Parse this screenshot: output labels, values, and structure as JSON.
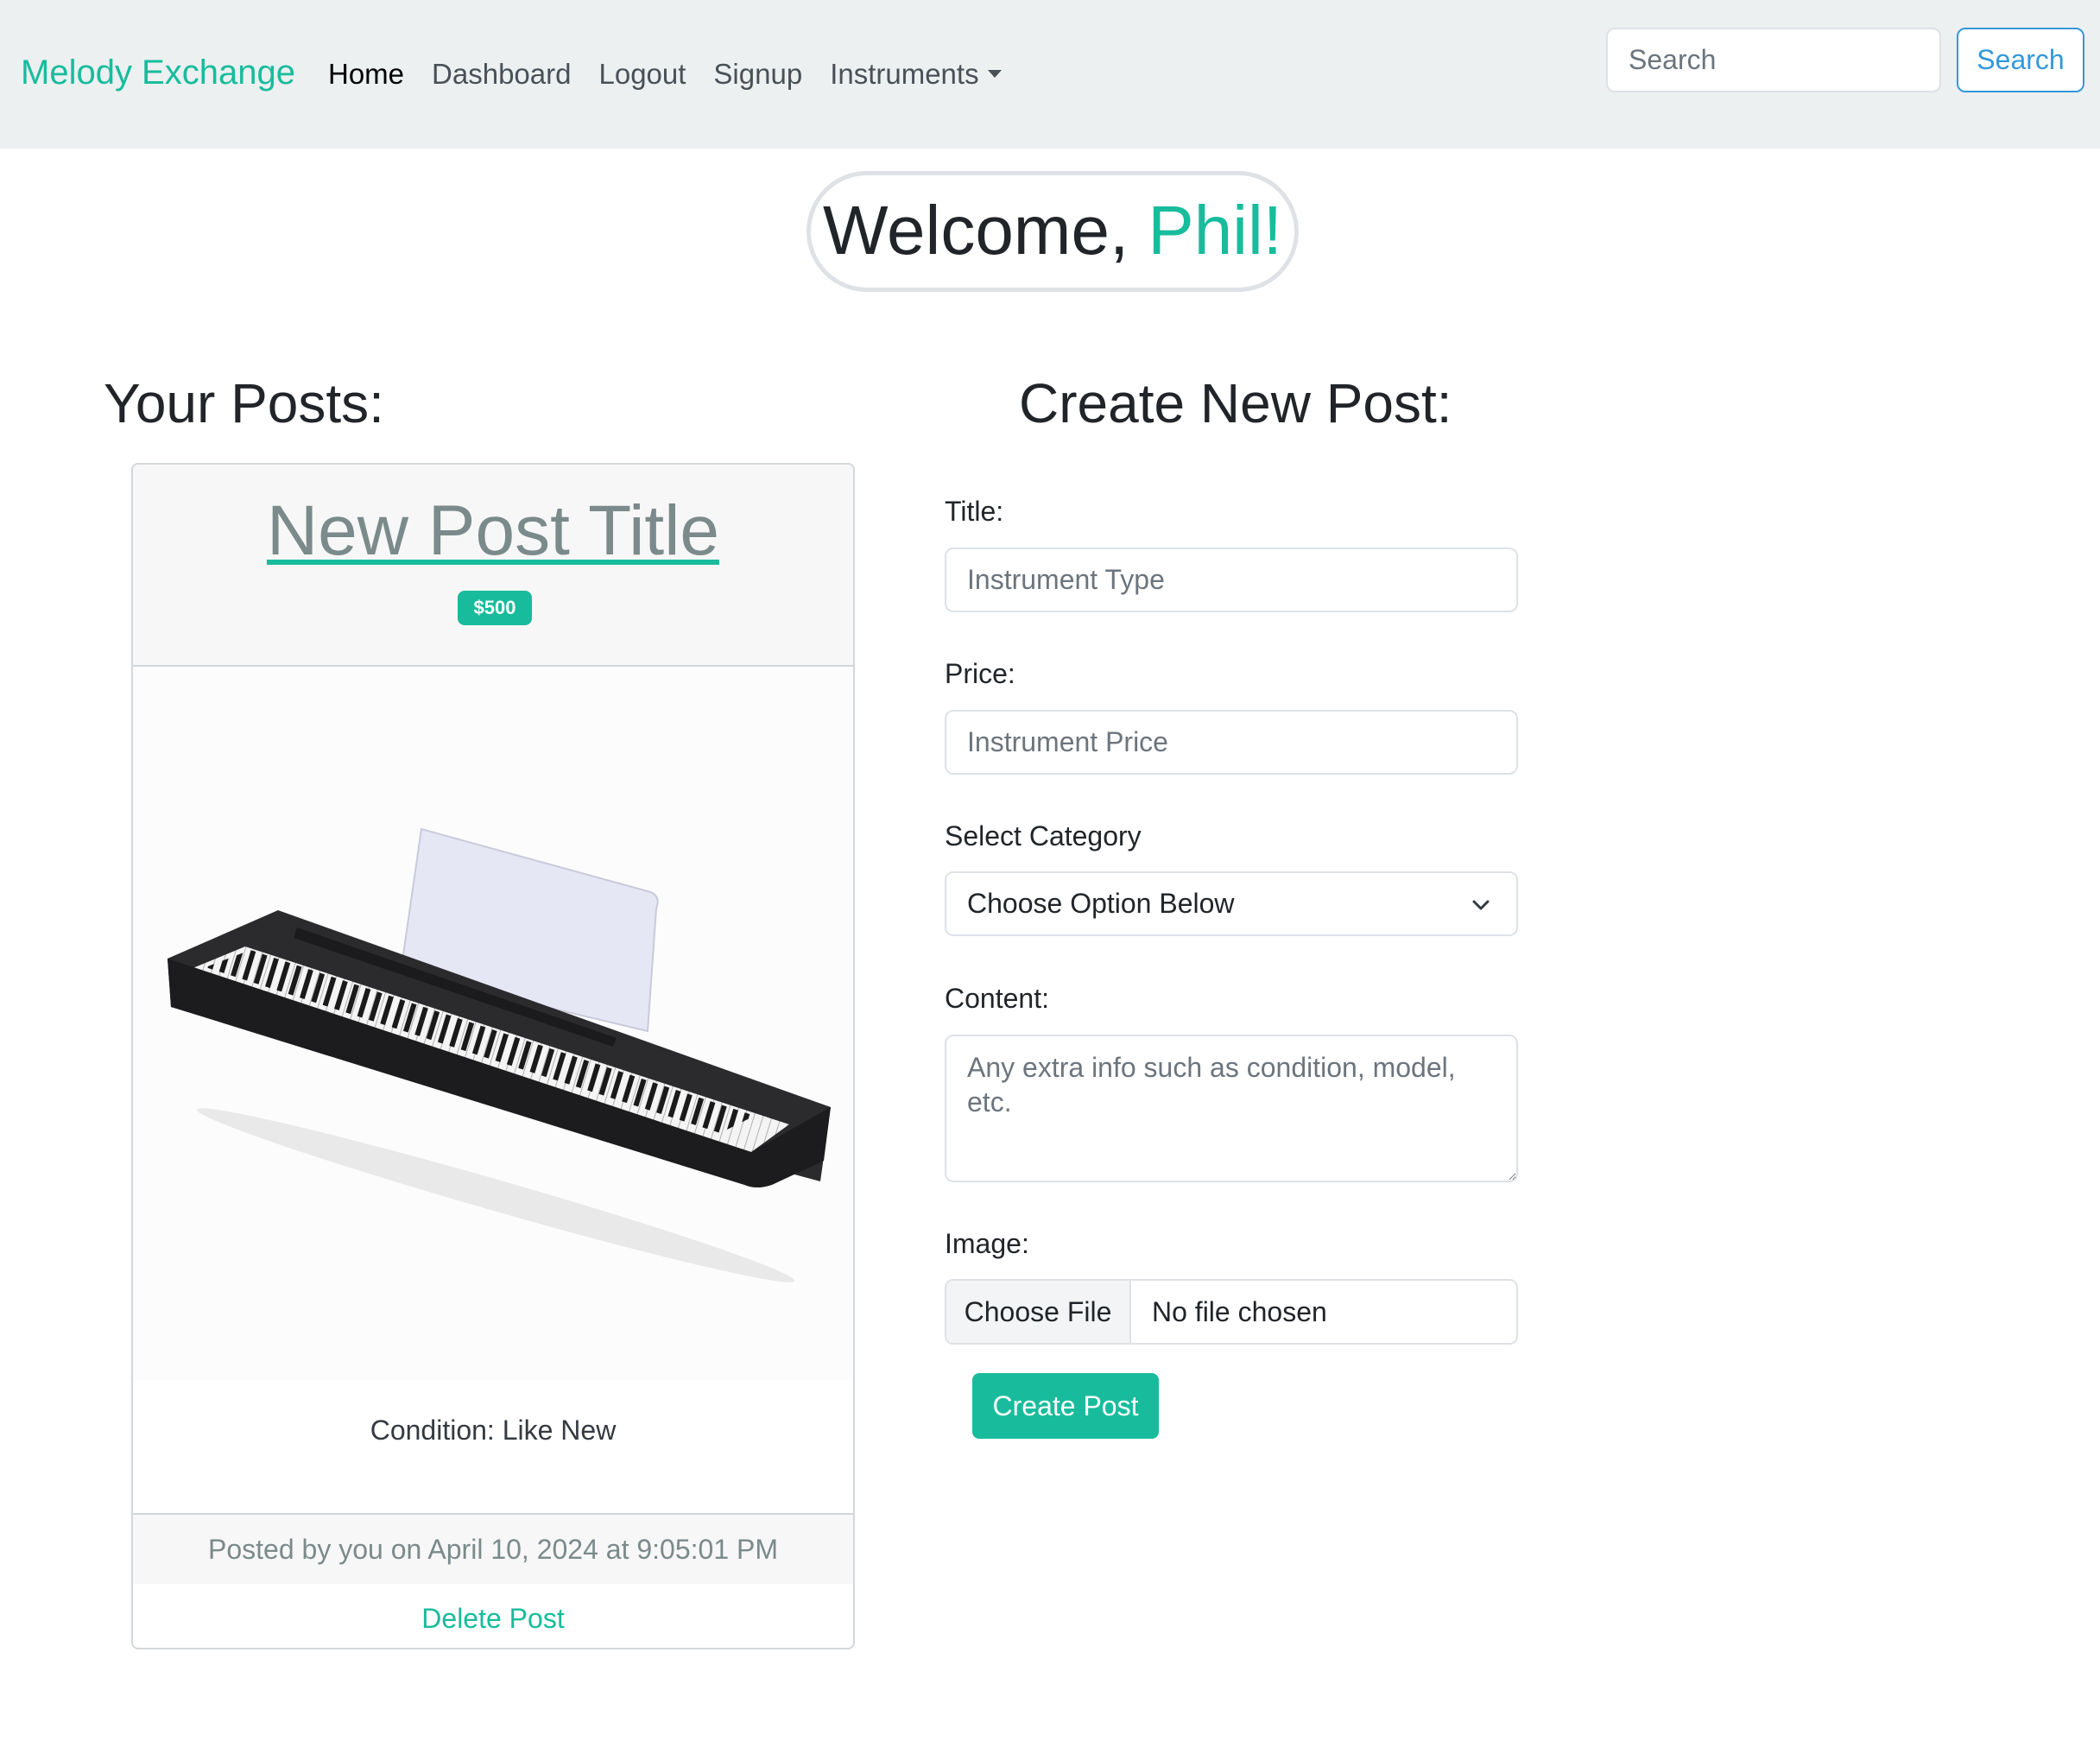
{
  "navbar": {
    "brand": "Melody Exchange",
    "links": [
      {
        "label": "Home",
        "active": true
      },
      {
        "label": "Dashboard"
      },
      {
        "label": "Logout"
      },
      {
        "label": "Signup"
      },
      {
        "label": "Instruments",
        "dropdown": true
      }
    ],
    "search_placeholder": "Search",
    "search_button": "Search"
  },
  "welcome": {
    "greeting": "Welcome, ",
    "name": "Phil!"
  },
  "your_posts": {
    "heading": "Your Posts:",
    "posts": [
      {
        "title": "New Post Title",
        "price": "$500",
        "image_icon": "digital-piano-image",
        "condition": "Condition: Like New",
        "posted": "Posted by you on April 10, 2024 at 9:05:01 PM",
        "delete_label": "Delete Post"
      }
    ]
  },
  "create_post": {
    "heading": "Create New Post:",
    "title_label": "Title:",
    "title_placeholder": "Instrument Type",
    "price_label": "Price:",
    "price_placeholder": "Instrument Price",
    "category_label": "Select Category",
    "category_selected": "Choose Option Below",
    "content_label": "Content:",
    "content_placeholder": "Any extra info such as condition, model, etc.",
    "image_label": "Image:",
    "file_button": "Choose File",
    "file_status": "No file chosen",
    "submit_label": "Create Post"
  },
  "colors": {
    "accent": "#18bc9c",
    "navbar_bg": "#ecf0f1",
    "search_blue": "#3498db",
    "muted": "#7b8a8b"
  }
}
